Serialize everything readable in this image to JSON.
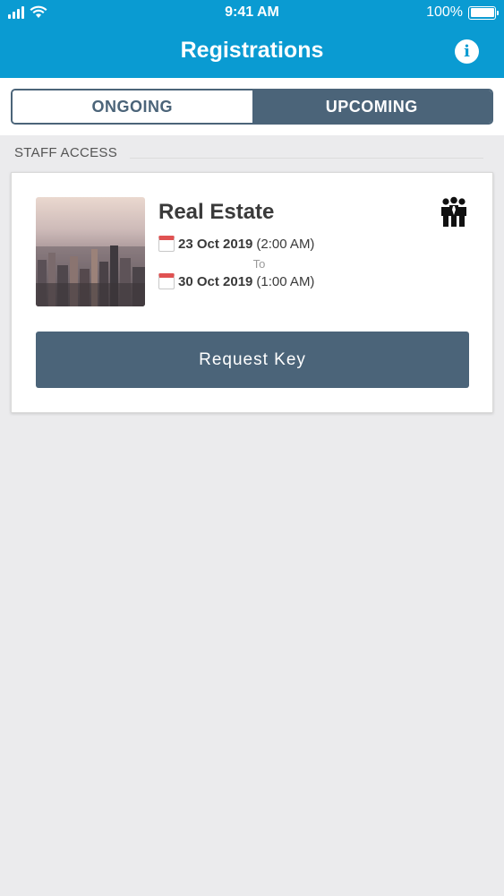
{
  "status_bar": {
    "time": "9:41 AM",
    "battery_percent": "100%",
    "battery_level": 1.0
  },
  "nav": {
    "title": "Registrations",
    "info_icon": "info-icon"
  },
  "tabs": [
    {
      "label": "ONGOING",
      "selected": false
    },
    {
      "label": "UPCOMING",
      "selected": true
    }
  ],
  "section": {
    "title": "STAFF ACCESS"
  },
  "registration": {
    "name": "Real Estate",
    "start_date": "23 Oct 2019",
    "start_time": "(2:00 AM)",
    "to_label": "To",
    "end_date": "30 Oct 2019",
    "end_time": "(1:00 AM)",
    "access_icon": "group-people-icon",
    "request_button": "Request Key"
  },
  "colors": {
    "header": "#0a9bd2",
    "accent": "#4b6479",
    "background": "#ebebed"
  }
}
